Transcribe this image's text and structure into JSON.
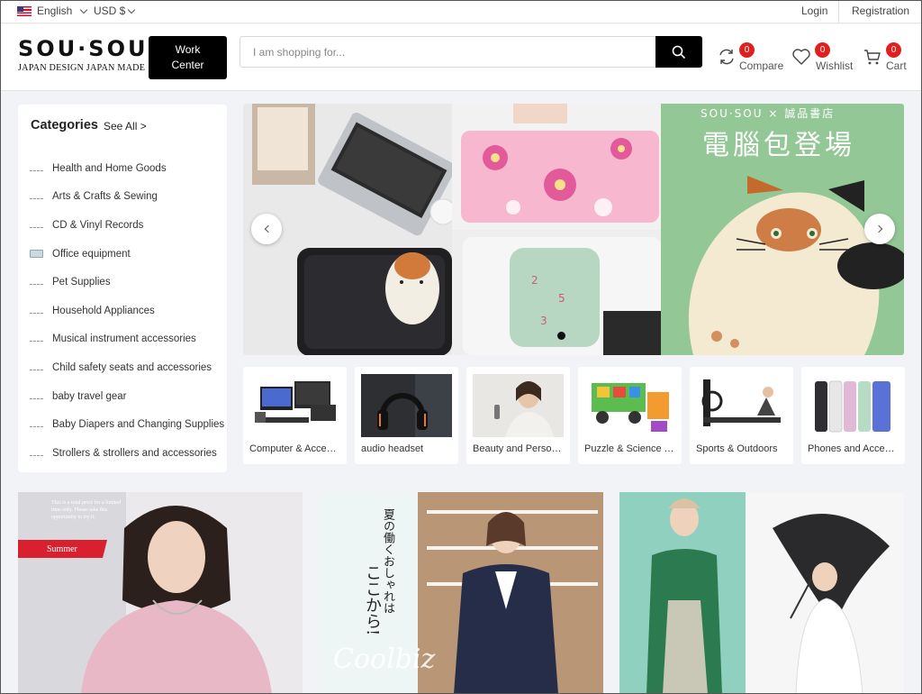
{
  "topbar": {
    "language": "English",
    "currency": "USD $",
    "login": "Login",
    "registration": "Registration"
  },
  "header": {
    "logo_main": "SOU·SOU",
    "logo_sub": "JAPAN DESIGN JAPAN MADE",
    "work_center_line1": "Work",
    "work_center_line2": "Center",
    "search_placeholder": "I am shopping for...",
    "compare_label": "Compare",
    "compare_count": "0",
    "wishlist_label": "Wishlist",
    "wishlist_count": "0",
    "cart_label": "Cart",
    "cart_count": "0"
  },
  "sidebar": {
    "title": "Categories",
    "see_all": "See All >",
    "items": [
      {
        "label": "Health and Home Goods"
      },
      {
        "label": "Arts & Crafts & Sewing"
      },
      {
        "label": "CD & Vinyl Records"
      },
      {
        "label": "Office equipment"
      },
      {
        "label": "Pet Supplies"
      },
      {
        "label": "Household Appliances"
      },
      {
        "label": "Musical instrument accessories"
      },
      {
        "label": "Child safety seats and accessories"
      },
      {
        "label": "baby travel gear"
      },
      {
        "label": "Baby Diapers and Changing Supplies"
      },
      {
        "label": "Strollers & strollers and accessories"
      }
    ]
  },
  "banner": {
    "brand_line": "SOU·SOU × 誠品書店",
    "headline": "電腦包登場",
    "slide_index": 1,
    "slide_total": 1
  },
  "tiles": [
    {
      "label": "Computer & Access…"
    },
    {
      "label": "audio headset"
    },
    {
      "label": "Beauty and Persona…"
    },
    {
      "label": "Puzzle & Science Toys"
    },
    {
      "label": "Sports & Outdoors"
    },
    {
      "label": "Phones and Access…"
    }
  ],
  "promos": {
    "summer_tag": "Summer",
    "tiny_copy": "This is a total price for a limited time only. Please take this opportunity to try it.",
    "vertical_line1": "夏の働くおしゃれは",
    "vertical_line2": "ここから!",
    "coolbiz": "Coolbiz"
  },
  "colors": {
    "accent_black": "#000000",
    "badge_red": "#e02020",
    "banner_green": "#93c796",
    "summer_red": "#d8202f"
  }
}
